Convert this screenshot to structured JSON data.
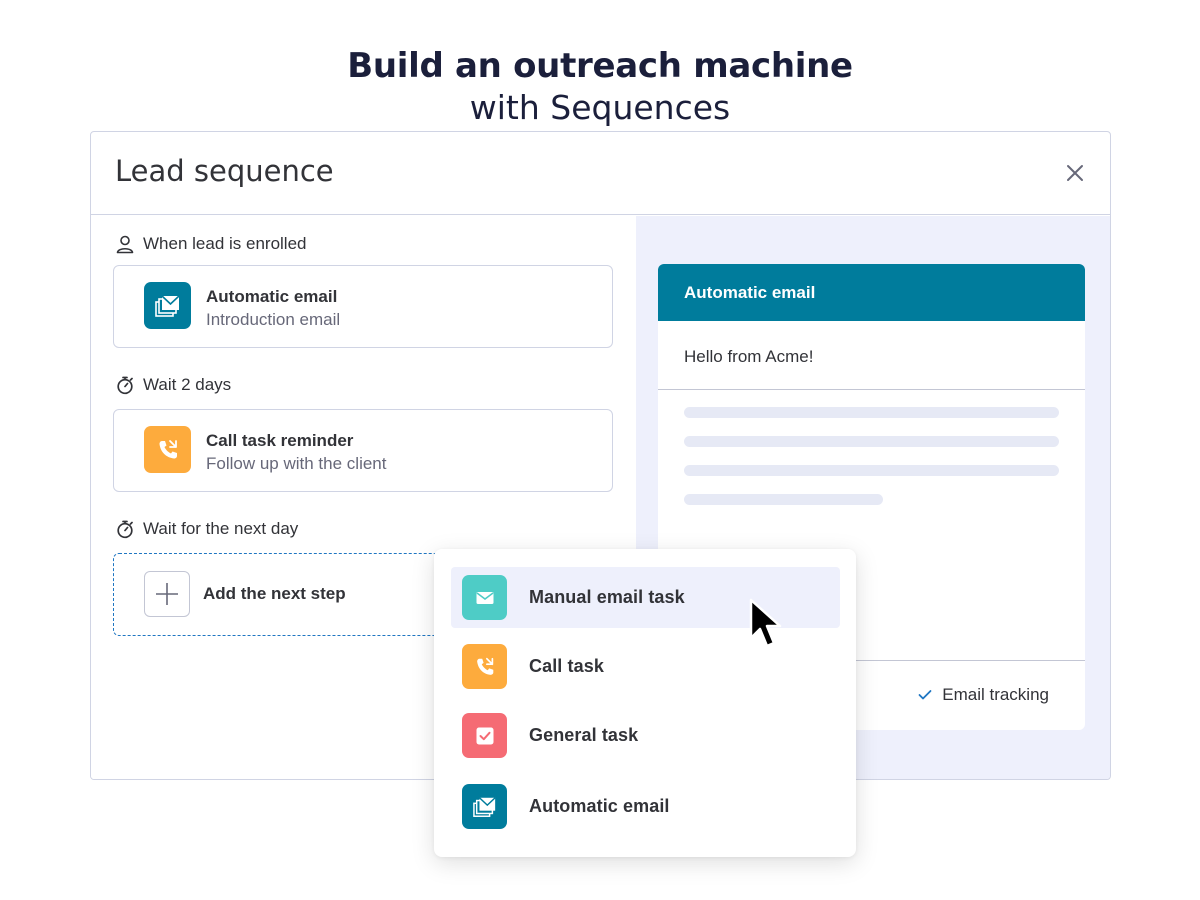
{
  "headline": {
    "bold": "Build an outreach machine",
    "light": "with Sequences"
  },
  "window": {
    "title": "Lead sequence",
    "close_icon": "close-icon"
  },
  "steps": [
    {
      "trigger": "When lead is enrolled",
      "trigger_icon": "person-icon",
      "title": "Automatic email",
      "subtitle": "Introduction email",
      "icon": "email-stack-icon",
      "color": "#007c9c"
    },
    {
      "trigger": "Wait 2 days",
      "trigger_icon": "stopwatch-icon",
      "title": "Call task reminder",
      "subtitle": "Follow up with the client",
      "icon": "phone-icon",
      "color": "#fdab3d"
    }
  ],
  "next_wait": {
    "label": "Wait for the next day",
    "icon": "stopwatch-icon"
  },
  "add_step": {
    "label": "Add the next step",
    "icon": "plus-icon"
  },
  "email_preview": {
    "header": "Automatic email",
    "subject": "Hello from Acme!",
    "tracking_label": "Email tracking",
    "tracking_checked": true
  },
  "dropdown": {
    "items": [
      {
        "label": "Manual email task",
        "icon": "envelope-icon",
        "color": "#4eccc6"
      },
      {
        "label": "Call task",
        "icon": "phone-icon",
        "color": "#fdab3d"
      },
      {
        "label": "General task",
        "icon": "checkbox-icon",
        "color": "#f56b74"
      },
      {
        "label": "Automatic email",
        "icon": "email-stack-icon",
        "color": "#007c9c"
      }
    ],
    "hovered_index": 0
  },
  "colors": {
    "accent": "#007c9c",
    "right_pane_bg": "#eef0fc",
    "dashed_border": "#1f76c2"
  }
}
